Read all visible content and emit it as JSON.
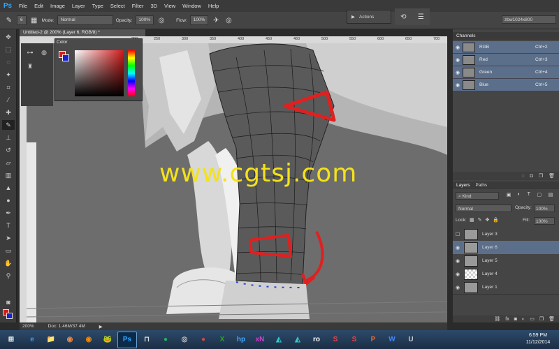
{
  "app": {
    "logo": "Ps"
  },
  "menu": [
    "File",
    "Edit",
    "Image",
    "Layer",
    "Type",
    "Select",
    "Filter",
    "3D",
    "View",
    "Window",
    "Help"
  ],
  "options": {
    "brush_size": "6",
    "mode_label": "Mode:",
    "mode_value": "Normal",
    "opacity_label": "Opacity:",
    "opacity_value": "100%",
    "flow_label": "Flow:",
    "flow_value": "100%"
  },
  "actions_label": "Actions",
  "workspace": "zbw1024x800",
  "document": {
    "tab": "Untitled-2 @ 200% (Layer 6, RGB/8) *",
    "zoom": "200%",
    "doc_size": "Doc: 1.46M/37.4M"
  },
  "ruler_ticks": [
    "200",
    "250",
    "300",
    "350",
    "400",
    "450",
    "460",
    "500",
    "550",
    "600",
    "650",
    "700"
  ],
  "color_panel": {
    "title": "Color",
    "accent": "#d21a1a"
  },
  "channels": {
    "title": "Channels",
    "rows": [
      {
        "name": "RGB",
        "shortcut": "Ctrl+2"
      },
      {
        "name": "Red",
        "shortcut": "Ctrl+3"
      },
      {
        "name": "Green",
        "shortcut": "Ctrl+4"
      },
      {
        "name": "Blue",
        "shortcut": "Ctrl+5"
      }
    ]
  },
  "layers": {
    "tabs": [
      "Layers",
      "Paths"
    ],
    "kind": "Kind",
    "blend_mode": "Normal",
    "opacity_label": "Opacity:",
    "opacity_value": "100%",
    "lock_label": "Lock:",
    "fill_label": "Fill:",
    "fill_value": "100%",
    "rows": [
      {
        "name": "Layer 3",
        "visible": false,
        "selected": false
      },
      {
        "name": "Layer 6",
        "visible": true,
        "selected": true
      },
      {
        "name": "Layer 5",
        "visible": true,
        "selected": false
      },
      {
        "name": "Layer 4",
        "visible": true,
        "selected": false
      },
      {
        "name": "Layer 1",
        "visible": true,
        "selected": false
      }
    ]
  },
  "watermark": "www.cgtsj.com",
  "taskbar": {
    "icons": [
      "e",
      "📁",
      "◉",
      "◉",
      "🐸",
      "Ps",
      "⊓",
      "●",
      "◎",
      "●",
      "X",
      "hp",
      "xN",
      "◭",
      "◭",
      "ro",
      "S",
      "S",
      "P",
      "W",
      "U"
    ],
    "time": "6:59 PM",
    "date": "11/12/2014"
  }
}
